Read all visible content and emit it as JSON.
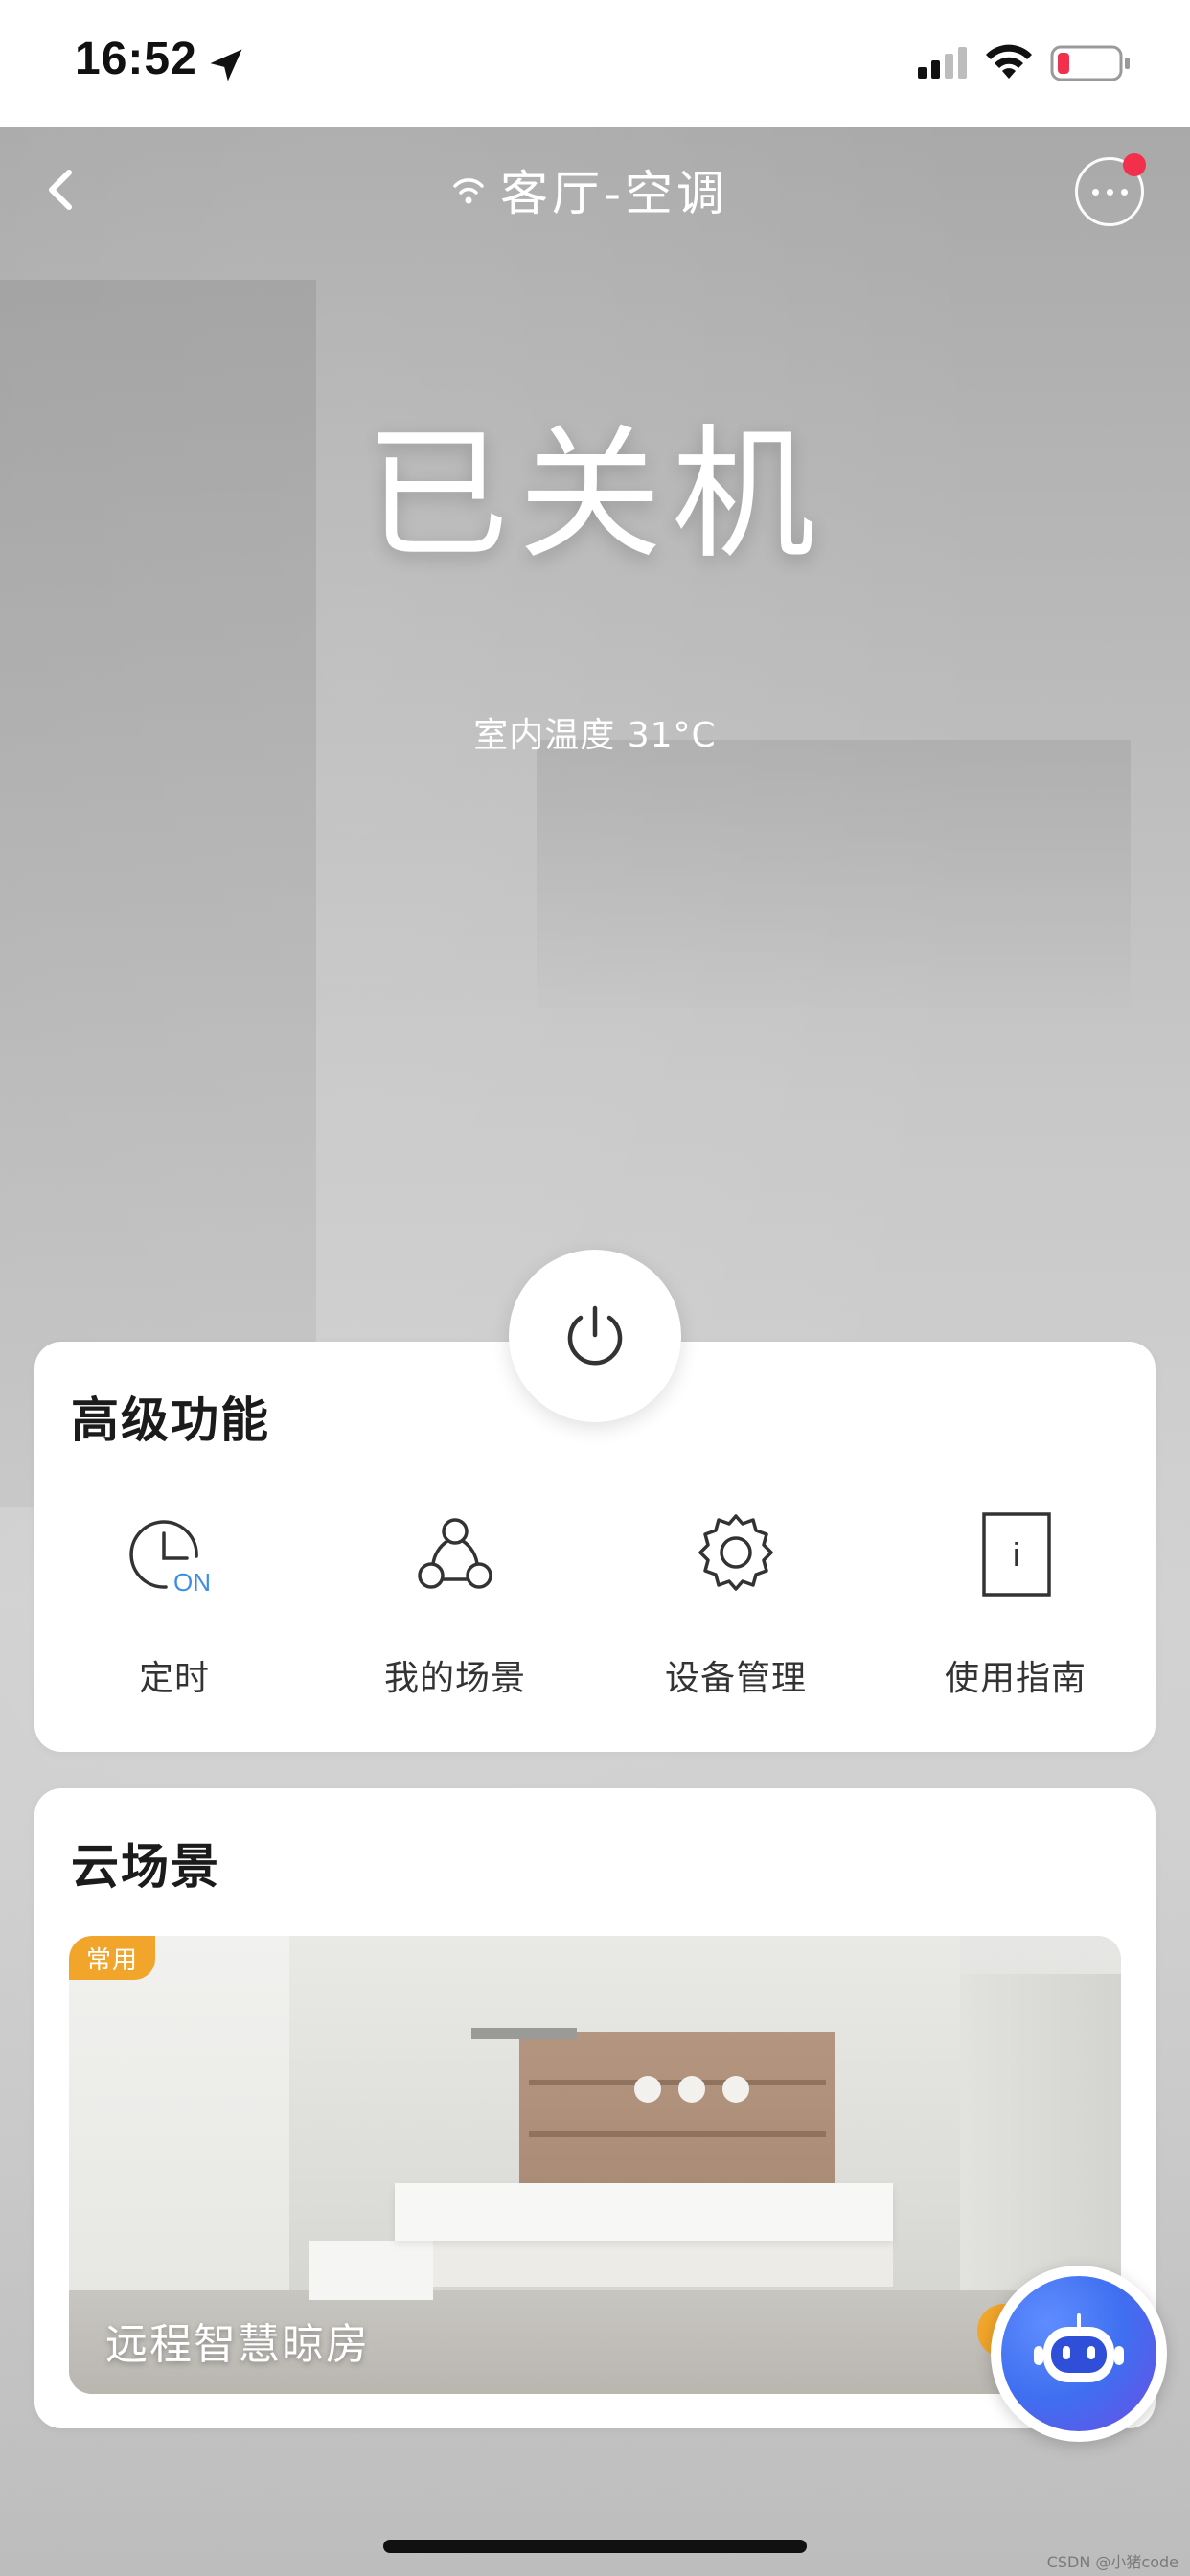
{
  "status_bar": {
    "time": "16:52",
    "icons": [
      "location-arrow-icon",
      "cellular-signal-icon",
      "wifi-icon",
      "battery-low-icon"
    ],
    "battery_color": "#f2304b"
  },
  "header": {
    "title": "客厅-空调",
    "connection_icon": "wifi-small-icon",
    "back_icon": "chevron-left-icon",
    "more_icon": "more-dots-icon",
    "notification_color": "#f2304b"
  },
  "device": {
    "status": "已关机",
    "indoor_temp": "室内温度 31°C"
  },
  "power_button": {
    "icon": "power-icon"
  },
  "advanced": {
    "title": "高级功能",
    "items": [
      {
        "label": "定时",
        "icon": "timer-on-icon",
        "icon_badge": "ON"
      },
      {
        "label": "我的场景",
        "icon": "scene-nodes-icon"
      },
      {
        "label": "设备管理",
        "icon": "gear-icon"
      },
      {
        "label": "使用指南",
        "icon": "guide-info-icon",
        "icon_glyph": "i"
      }
    ]
  },
  "cloud_scene": {
    "title": "云场景",
    "card": {
      "badge": "常用",
      "name": "远程智慧晾房",
      "action_label": "开"
    }
  },
  "assistant": {
    "icon": "robot-assistant-icon"
  },
  "watermark": "CSDN @小猪code",
  "colors": {
    "accent_orange": "#f1a52a",
    "accent_blue": "#3b8ee8",
    "notification_red": "#f2304b"
  }
}
